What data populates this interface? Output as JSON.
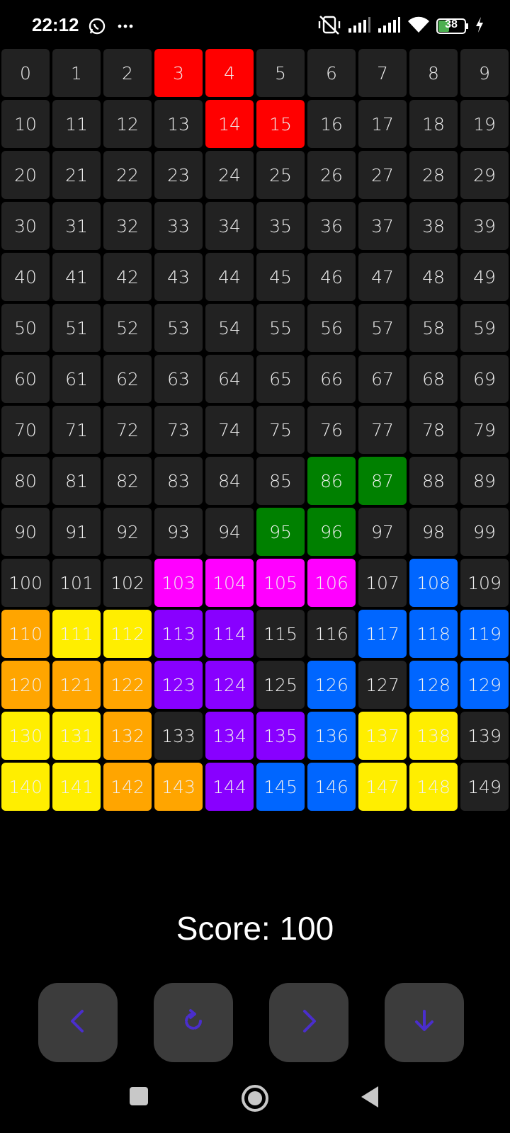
{
  "status_bar": {
    "time": "22:12",
    "icons_left": [
      "whatsapp-icon",
      "more-dots-icon"
    ],
    "icons_right": [
      "vibrate-off-icon",
      "signal-icon",
      "signal-icon",
      "wifi-icon",
      "battery-icon",
      "charging-bolt-icon"
    ],
    "battery_level": "38"
  },
  "board": {
    "columns": 10,
    "colors": {
      "empty": "#222222",
      "red": "#ff0000",
      "green": "#008000",
      "magenta": "#ff00ff",
      "blue": "#0066ff",
      "orange": "#ffa500",
      "yellow": "#ffee00",
      "purple": "#8800ff"
    },
    "cells": [
      {
        "label": "0",
        "color": "empty"
      },
      {
        "label": "1",
        "color": "empty"
      },
      {
        "label": "2",
        "color": "empty"
      },
      {
        "label": "3",
        "color": "red"
      },
      {
        "label": "4",
        "color": "red"
      },
      {
        "label": "5",
        "color": "empty"
      },
      {
        "label": "6",
        "color": "empty"
      },
      {
        "label": "7",
        "color": "empty"
      },
      {
        "label": "8",
        "color": "empty"
      },
      {
        "label": "9",
        "color": "empty"
      },
      {
        "label": "10",
        "color": "empty"
      },
      {
        "label": "11",
        "color": "empty"
      },
      {
        "label": "12",
        "color": "empty"
      },
      {
        "label": "13",
        "color": "empty"
      },
      {
        "label": "14",
        "color": "red"
      },
      {
        "label": "15",
        "color": "red"
      },
      {
        "label": "16",
        "color": "empty"
      },
      {
        "label": "17",
        "color": "empty"
      },
      {
        "label": "18",
        "color": "empty"
      },
      {
        "label": "19",
        "color": "empty"
      },
      {
        "label": "20",
        "color": "empty"
      },
      {
        "label": "21",
        "color": "empty"
      },
      {
        "label": "22",
        "color": "empty"
      },
      {
        "label": "23",
        "color": "empty"
      },
      {
        "label": "24",
        "color": "empty"
      },
      {
        "label": "25",
        "color": "empty"
      },
      {
        "label": "26",
        "color": "empty"
      },
      {
        "label": "27",
        "color": "empty"
      },
      {
        "label": "28",
        "color": "empty"
      },
      {
        "label": "29",
        "color": "empty"
      },
      {
        "label": "30",
        "color": "empty"
      },
      {
        "label": "31",
        "color": "empty"
      },
      {
        "label": "32",
        "color": "empty"
      },
      {
        "label": "33",
        "color": "empty"
      },
      {
        "label": "34",
        "color": "empty"
      },
      {
        "label": "35",
        "color": "empty"
      },
      {
        "label": "36",
        "color": "empty"
      },
      {
        "label": "37",
        "color": "empty"
      },
      {
        "label": "38",
        "color": "empty"
      },
      {
        "label": "39",
        "color": "empty"
      },
      {
        "label": "40",
        "color": "empty"
      },
      {
        "label": "41",
        "color": "empty"
      },
      {
        "label": "42",
        "color": "empty"
      },
      {
        "label": "43",
        "color": "empty"
      },
      {
        "label": "44",
        "color": "empty"
      },
      {
        "label": "45",
        "color": "empty"
      },
      {
        "label": "46",
        "color": "empty"
      },
      {
        "label": "47",
        "color": "empty"
      },
      {
        "label": "48",
        "color": "empty"
      },
      {
        "label": "49",
        "color": "empty"
      },
      {
        "label": "50",
        "color": "empty"
      },
      {
        "label": "51",
        "color": "empty"
      },
      {
        "label": "52",
        "color": "empty"
      },
      {
        "label": "53",
        "color": "empty"
      },
      {
        "label": "54",
        "color": "empty"
      },
      {
        "label": "55",
        "color": "empty"
      },
      {
        "label": "56",
        "color": "empty"
      },
      {
        "label": "57",
        "color": "empty"
      },
      {
        "label": "58",
        "color": "empty"
      },
      {
        "label": "59",
        "color": "empty"
      },
      {
        "label": "60",
        "color": "empty"
      },
      {
        "label": "61",
        "color": "empty"
      },
      {
        "label": "62",
        "color": "empty"
      },
      {
        "label": "63",
        "color": "empty"
      },
      {
        "label": "64",
        "color": "empty"
      },
      {
        "label": "65",
        "color": "empty"
      },
      {
        "label": "66",
        "color": "empty"
      },
      {
        "label": "67",
        "color": "empty"
      },
      {
        "label": "68",
        "color": "empty"
      },
      {
        "label": "69",
        "color": "empty"
      },
      {
        "label": "70",
        "color": "empty"
      },
      {
        "label": "71",
        "color": "empty"
      },
      {
        "label": "72",
        "color": "empty"
      },
      {
        "label": "73",
        "color": "empty"
      },
      {
        "label": "74",
        "color": "empty"
      },
      {
        "label": "75",
        "color": "empty"
      },
      {
        "label": "76",
        "color": "empty"
      },
      {
        "label": "77",
        "color": "empty"
      },
      {
        "label": "78",
        "color": "empty"
      },
      {
        "label": "79",
        "color": "empty"
      },
      {
        "label": "80",
        "color": "empty"
      },
      {
        "label": "81",
        "color": "empty"
      },
      {
        "label": "82",
        "color": "empty"
      },
      {
        "label": "83",
        "color": "empty"
      },
      {
        "label": "84",
        "color": "empty"
      },
      {
        "label": "85",
        "color": "empty"
      },
      {
        "label": "86",
        "color": "green"
      },
      {
        "label": "87",
        "color": "green"
      },
      {
        "label": "88",
        "color": "empty"
      },
      {
        "label": "89",
        "color": "empty"
      },
      {
        "label": "90",
        "color": "empty"
      },
      {
        "label": "91",
        "color": "empty"
      },
      {
        "label": "92",
        "color": "empty"
      },
      {
        "label": "93",
        "color": "empty"
      },
      {
        "label": "94",
        "color": "empty"
      },
      {
        "label": "95",
        "color": "green"
      },
      {
        "label": "96",
        "color": "green"
      },
      {
        "label": "97",
        "color": "empty"
      },
      {
        "label": "98",
        "color": "empty"
      },
      {
        "label": "99",
        "color": "empty"
      },
      {
        "label": "100",
        "color": "empty"
      },
      {
        "label": "101",
        "color": "empty"
      },
      {
        "label": "102",
        "color": "empty"
      },
      {
        "label": "103",
        "color": "magenta"
      },
      {
        "label": "104",
        "color": "magenta"
      },
      {
        "label": "105",
        "color": "magenta"
      },
      {
        "label": "106",
        "color": "magenta"
      },
      {
        "label": "107",
        "color": "empty"
      },
      {
        "label": "108",
        "color": "blue"
      },
      {
        "label": "109",
        "color": "empty"
      },
      {
        "label": "110",
        "color": "orange"
      },
      {
        "label": "111",
        "color": "yellow"
      },
      {
        "label": "112",
        "color": "yellow"
      },
      {
        "label": "113",
        "color": "purple"
      },
      {
        "label": "114",
        "color": "purple"
      },
      {
        "label": "115",
        "color": "empty"
      },
      {
        "label": "116",
        "color": "empty"
      },
      {
        "label": "117",
        "color": "blue"
      },
      {
        "label": "118",
        "color": "blue"
      },
      {
        "label": "119",
        "color": "blue"
      },
      {
        "label": "120",
        "color": "orange"
      },
      {
        "label": "121",
        "color": "orange"
      },
      {
        "label": "122",
        "color": "orange"
      },
      {
        "label": "123",
        "color": "purple"
      },
      {
        "label": "124",
        "color": "purple"
      },
      {
        "label": "125",
        "color": "empty"
      },
      {
        "label": "126",
        "color": "blue"
      },
      {
        "label": "127",
        "color": "empty"
      },
      {
        "label": "128",
        "color": "blue"
      },
      {
        "label": "129",
        "color": "blue"
      },
      {
        "label": "130",
        "color": "yellow"
      },
      {
        "label": "131",
        "color": "yellow"
      },
      {
        "label": "132",
        "color": "orange"
      },
      {
        "label": "133",
        "color": "empty"
      },
      {
        "label": "134",
        "color": "purple"
      },
      {
        "label": "135",
        "color": "purple"
      },
      {
        "label": "136",
        "color": "blue"
      },
      {
        "label": "137",
        "color": "yellow"
      },
      {
        "label": "138",
        "color": "yellow"
      },
      {
        "label": "139",
        "color": "empty"
      },
      {
        "label": "140",
        "color": "yellow"
      },
      {
        "label": "141",
        "color": "yellow"
      },
      {
        "label": "142",
        "color": "orange"
      },
      {
        "label": "143",
        "color": "orange"
      },
      {
        "label": "144",
        "color": "purple"
      },
      {
        "label": "145",
        "color": "blue"
      },
      {
        "label": "146",
        "color": "blue"
      },
      {
        "label": "147",
        "color": "yellow"
      },
      {
        "label": "148",
        "color": "yellow"
      },
      {
        "label": "149",
        "color": "empty"
      }
    ]
  },
  "score_text": "Score: 100",
  "controls": {
    "icon_color": "#4a2ecc",
    "button_color": "#3c3c3c",
    "buttons": [
      {
        "name": "move-left-button",
        "icon": "chevron-left-icon"
      },
      {
        "name": "rotate-button",
        "icon": "rotate-icon"
      },
      {
        "name": "move-right-button",
        "icon": "chevron-right-icon"
      },
      {
        "name": "drop-button",
        "icon": "arrow-down-icon"
      }
    ]
  },
  "navbar": {
    "items": [
      "recents-square-icon",
      "home-circle-icon",
      "back-triangle-icon"
    ]
  }
}
